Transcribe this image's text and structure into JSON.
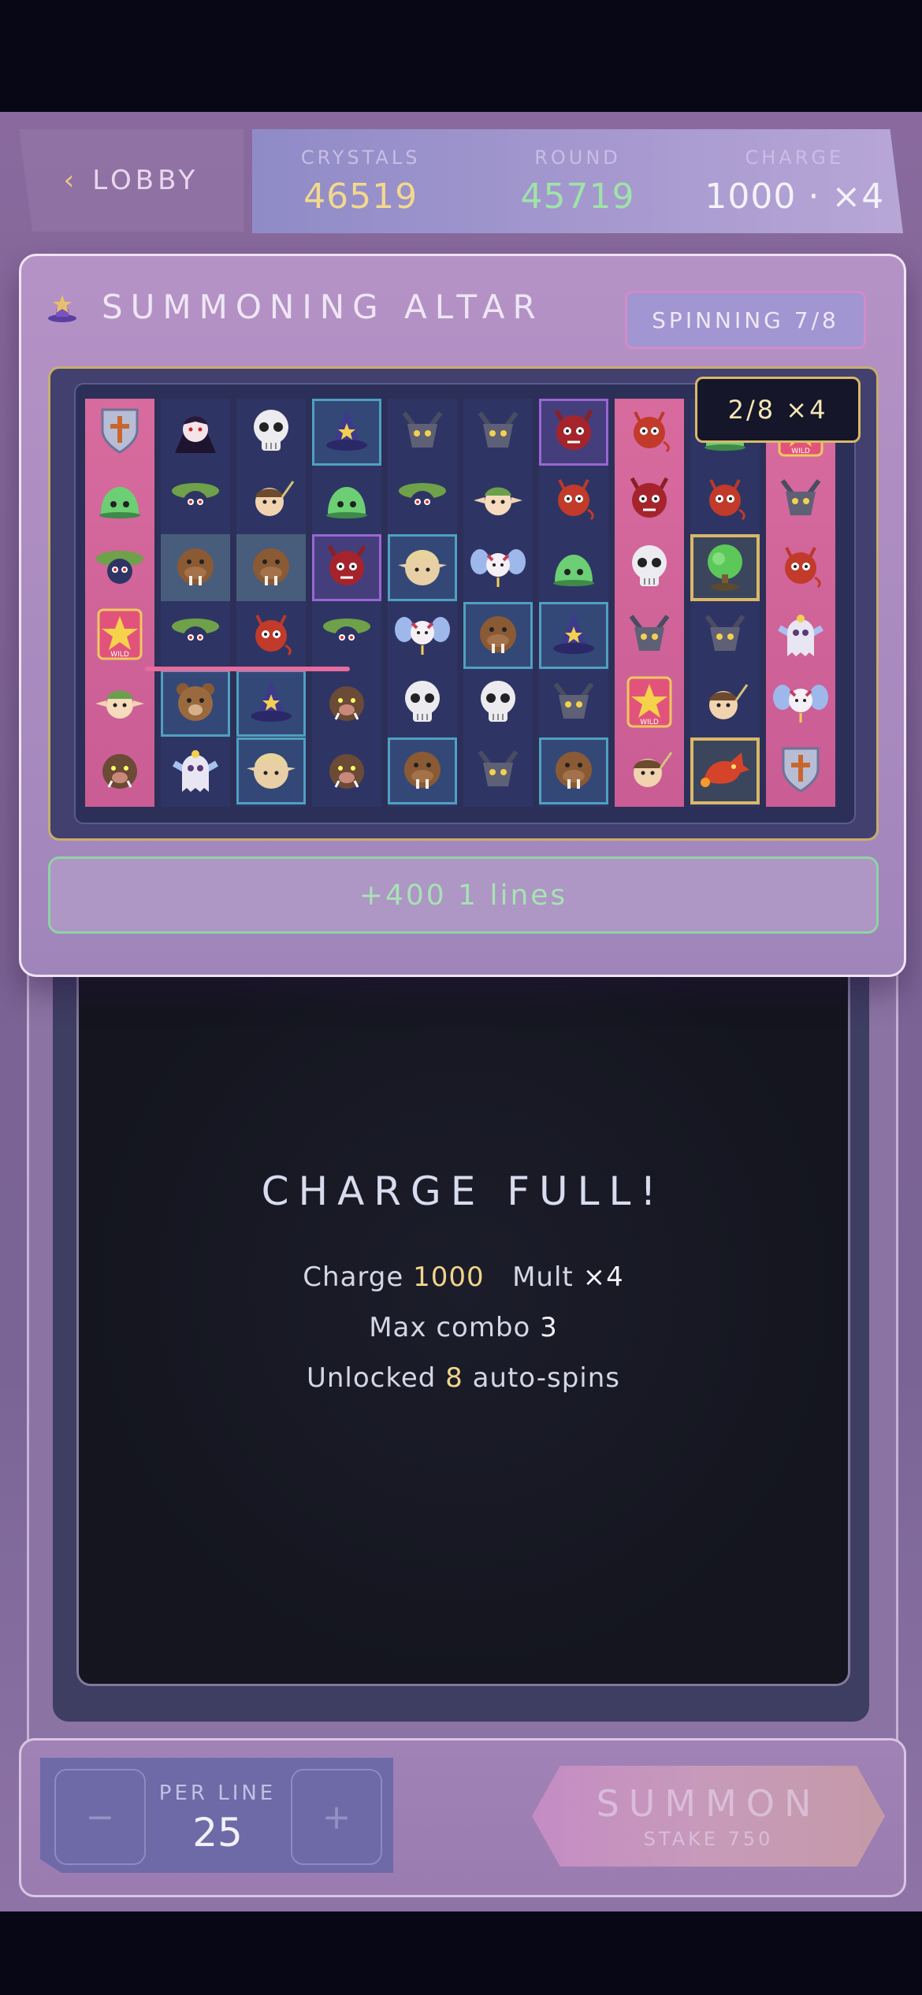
{
  "topbar": {
    "lobby_label": "LOBBY",
    "stats": [
      {
        "label": "CRYSTALS",
        "value": "46519",
        "color": "#f3d88e"
      },
      {
        "label": "ROUND",
        "value": "45719",
        "color": "#9fe3a8"
      },
      {
        "label": "CHARGE",
        "value": "1000 · ×4",
        "color": "#f4f2fa"
      }
    ]
  },
  "altar": {
    "title": "SUMMONING ALTAR",
    "status": "SPINNING 7/8",
    "combo_badge": "2/8 ×4",
    "win_text": "+400 1 lines"
  },
  "reels": [
    {
      "style": "pink",
      "cells": [
        {
          "sym": "shield",
          "hl": ""
        },
        {
          "sym": "slime",
          "hl": ""
        },
        {
          "sym": "goblin",
          "hl": ""
        },
        {
          "sym": "wild",
          "hl": ""
        },
        {
          "sym": "elf",
          "hl": ""
        },
        {
          "sym": "boar",
          "hl": ""
        }
      ]
    },
    {
      "style": "navy",
      "cells": [
        {
          "sym": "vampire",
          "hl": ""
        },
        {
          "sym": "goblin",
          "hl": ""
        },
        {
          "sym": "walrus",
          "hl": "teal"
        },
        {
          "sym": "goblin",
          "hl": ""
        },
        {
          "sym": "bear",
          "hl": "blue"
        },
        {
          "sym": "ghost",
          "hl": ""
        }
      ]
    },
    {
      "style": "navy",
      "cells": [
        {
          "sym": "skull",
          "hl": ""
        },
        {
          "sym": "soldier",
          "hl": ""
        },
        {
          "sym": "walrus",
          "hl": "teal"
        },
        {
          "sym": "imp",
          "hl": ""
        },
        {
          "sym": "hat",
          "hl": "blue"
        },
        {
          "sym": "elfface",
          "hl": "blue"
        }
      ]
    },
    {
      "style": "navy",
      "cells": [
        {
          "sym": "hat",
          "hl": "blue"
        },
        {
          "sym": "slime",
          "hl": ""
        },
        {
          "sym": "demon",
          "hl": "purple"
        },
        {
          "sym": "goblin",
          "hl": ""
        },
        {
          "sym": "boar",
          "hl": ""
        },
        {
          "sym": "boar",
          "hl": ""
        }
      ]
    },
    {
      "style": "navy",
      "cells": [
        {
          "sym": "gargoyle",
          "hl": ""
        },
        {
          "sym": "goblin",
          "hl": ""
        },
        {
          "sym": "elfface",
          "hl": "blue"
        },
        {
          "sym": "fairy",
          "hl": ""
        },
        {
          "sym": "skull",
          "hl": ""
        },
        {
          "sym": "walrus",
          "hl": "blue"
        }
      ]
    },
    {
      "style": "navy",
      "cells": [
        {
          "sym": "gargoyle",
          "hl": ""
        },
        {
          "sym": "elf",
          "hl": ""
        },
        {
          "sym": "fairy",
          "hl": ""
        },
        {
          "sym": "walrus",
          "hl": "blue"
        },
        {
          "sym": "skull",
          "hl": ""
        },
        {
          "sym": "gargoyle",
          "hl": ""
        }
      ]
    },
    {
      "style": "navy",
      "cells": [
        {
          "sym": "demon",
          "hl": "purple"
        },
        {
          "sym": "imp",
          "hl": ""
        },
        {
          "sym": "slime",
          "hl": ""
        },
        {
          "sym": "hat",
          "hl": "blue"
        },
        {
          "sym": "gargoyle",
          "hl": ""
        },
        {
          "sym": "walrus",
          "hl": "blue"
        }
      ]
    },
    {
      "style": "pink",
      "cells": [
        {
          "sym": "imp",
          "hl": ""
        },
        {
          "sym": "demon",
          "hl": ""
        },
        {
          "sym": "skull",
          "hl": ""
        },
        {
          "sym": "gargoyle",
          "hl": ""
        },
        {
          "sym": "wild",
          "hl": ""
        },
        {
          "sym": "soldier",
          "hl": ""
        }
      ]
    },
    {
      "style": "navy",
      "cells": [
        {
          "sym": "slime",
          "hl": ""
        },
        {
          "sym": "imp",
          "hl": ""
        },
        {
          "sym": "tree",
          "hl": "gold"
        },
        {
          "sym": "gargoyle",
          "hl": ""
        },
        {
          "sym": "soldier",
          "hl": ""
        },
        {
          "sym": "dragon",
          "hl": "gold"
        }
      ]
    },
    {
      "style": "pink",
      "cells": [
        {
          "sym": "wild",
          "hl": ""
        },
        {
          "sym": "gargoyle",
          "hl": ""
        },
        {
          "sym": "imp",
          "hl": ""
        },
        {
          "sym": "ghost",
          "hl": ""
        },
        {
          "sym": "fairy",
          "hl": ""
        },
        {
          "sym": "shield",
          "hl": ""
        }
      ]
    }
  ],
  "result": {
    "title": "CHARGE FULL!",
    "charge_label": "Charge",
    "charge_value": "1000",
    "mult_label": "Mult",
    "mult_value": "×4",
    "combo_label": "Max combo",
    "combo_value": "3",
    "unlock_prefix": "Unlocked",
    "unlock_value": "8",
    "unlock_suffix": "auto-spins"
  },
  "controls": {
    "minus_label": "−",
    "plus_label": "+",
    "per_line_label": "PER LINE",
    "per_line_value": "25",
    "summon_label": "SUMMON",
    "stake_label": "STAKE 750"
  },
  "symbol_icons": {
    "shield": "shield-icon",
    "slime": "slime-icon",
    "goblin": "goblin-icon",
    "wild": "wild-star-icon",
    "elf": "elf-icon",
    "boar": "boar-icon",
    "vampire": "vampire-icon",
    "walrus": "walrus-icon",
    "bear": "bear-icon",
    "ghost": "ghost-icon",
    "skull": "skull-icon",
    "soldier": "soldier-icon",
    "imp": "imp-icon",
    "hat": "wizard-hat-icon",
    "elfface": "elf-face-icon",
    "demon": "demon-icon",
    "gargoyle": "gargoyle-icon",
    "fairy": "fairy-icon",
    "tree": "tree-icon",
    "dragon": "dragon-icon"
  }
}
